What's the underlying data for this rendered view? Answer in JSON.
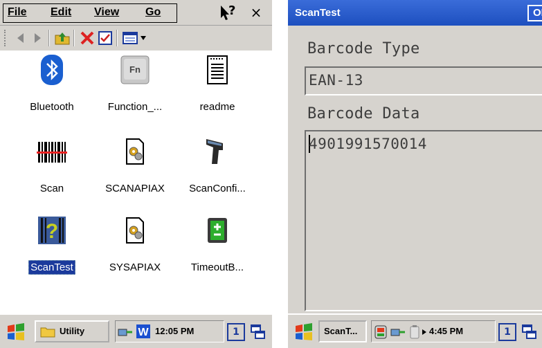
{
  "left_screen": {
    "menu": {
      "file": "File",
      "edit": "Edit",
      "view": "View",
      "go": "Go",
      "help": "?",
      "close": "×"
    },
    "files": [
      {
        "name": "Bluetooth",
        "icon": "bluetooth-icon"
      },
      {
        "name": "Function_...",
        "icon": "function-key-icon"
      },
      {
        "name": "readme",
        "icon": "document-icon"
      },
      {
        "name": "Scan",
        "icon": "barcode-icon"
      },
      {
        "name": "SCANAPIAX",
        "icon": "gear-file-icon"
      },
      {
        "name": "ScanConfi...",
        "icon": "scanner-gun-icon"
      },
      {
        "name": "ScanTest",
        "icon": "scantest-app-icon",
        "selected": true
      },
      {
        "name": "SYSAPIAX",
        "icon": "gear-file-icon"
      },
      {
        "name": "TimeoutB...",
        "icon": "battery-icon"
      }
    ],
    "taskbar": {
      "task_label": "Utility",
      "time": "12:05 PM",
      "input_number": "1"
    }
  },
  "right_screen": {
    "title": "ScanTest",
    "ok_label": "OK",
    "barcode_type_label": "Barcode Type",
    "barcode_type_value": "EAN-13",
    "barcode_data_label": "Barcode Data",
    "barcode_data_value": "4901991570014",
    "taskbar": {
      "task_label": "ScanT...",
      "time": "4:45 PM",
      "input_number": "1"
    }
  },
  "colors": {
    "selection": "#1b3a9c",
    "titlebar": "#2a5bd0",
    "chrome": "#d6d3ce"
  }
}
